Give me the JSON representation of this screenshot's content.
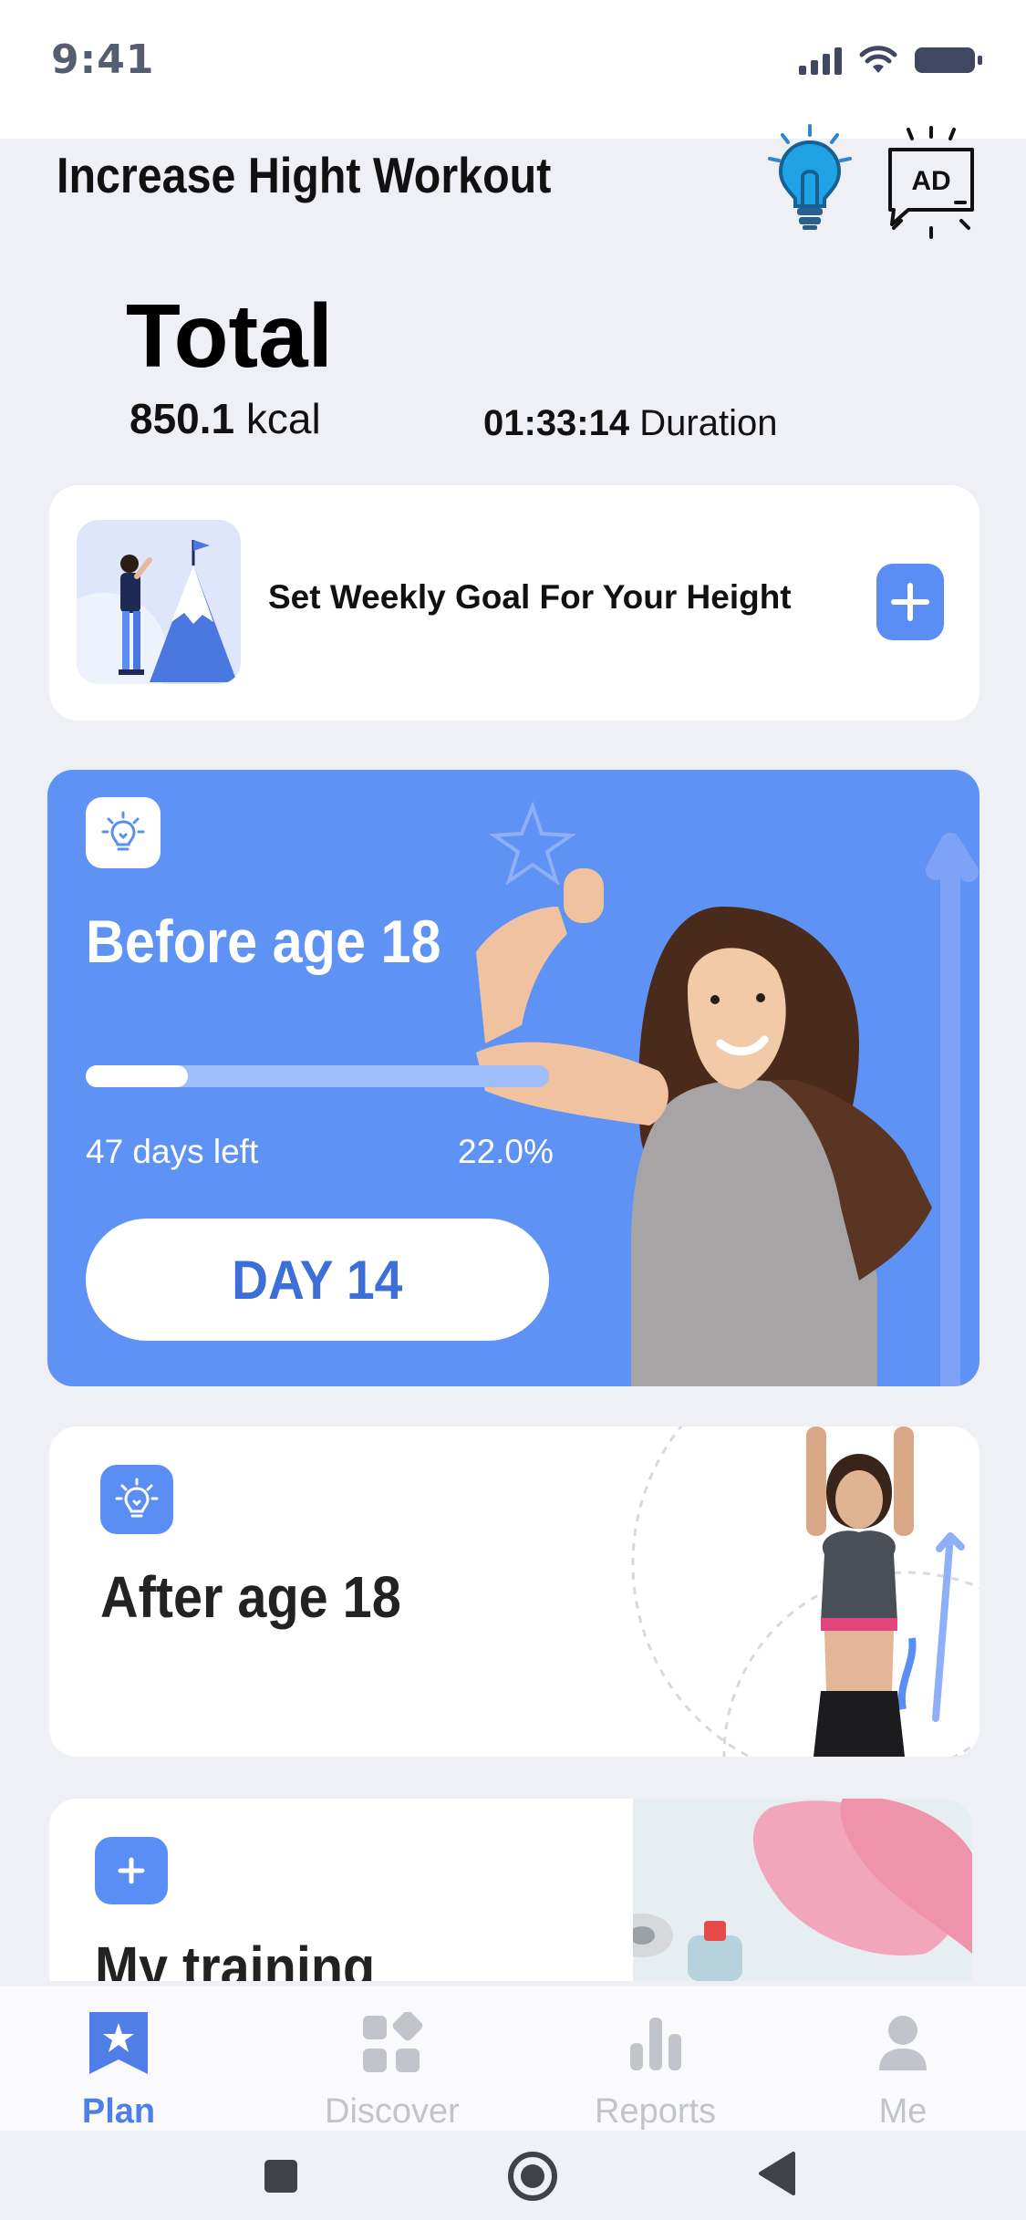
{
  "status_bar": {
    "time": "9:41"
  },
  "header": {
    "title": "Increase Hight Workout",
    "ad_label": "AD"
  },
  "summary": {
    "title": "Total",
    "kcal_value": "850.1",
    "kcal_unit": "kcal",
    "duration_value": "01:33:14",
    "duration_label": "Duration"
  },
  "goal_card": {
    "text": "Set Weekly Goal For Your Height"
  },
  "before_card": {
    "title": "Before age 18",
    "days_left": "47 days left",
    "percent_label": "22.0%",
    "progress_fraction": 0.22,
    "button_label": "DAY 14"
  },
  "after_card": {
    "title": "After age 18"
  },
  "training_card": {
    "title": "My training"
  },
  "bottom_nav": {
    "items": [
      {
        "label": "Plan",
        "icon": "star-bookmark-icon",
        "active": true
      },
      {
        "label": "Discover",
        "icon": "grid-icon",
        "active": false
      },
      {
        "label": "Reports",
        "icon": "bar-chart-icon",
        "active": false
      },
      {
        "label": "Me",
        "icon": "person-icon",
        "active": false
      }
    ]
  },
  "colors": {
    "accent": "#5b8ef5",
    "background": "#eff0f6",
    "active_nav": "#4f7fe6",
    "inactive_nav": "#c2c4cb"
  }
}
